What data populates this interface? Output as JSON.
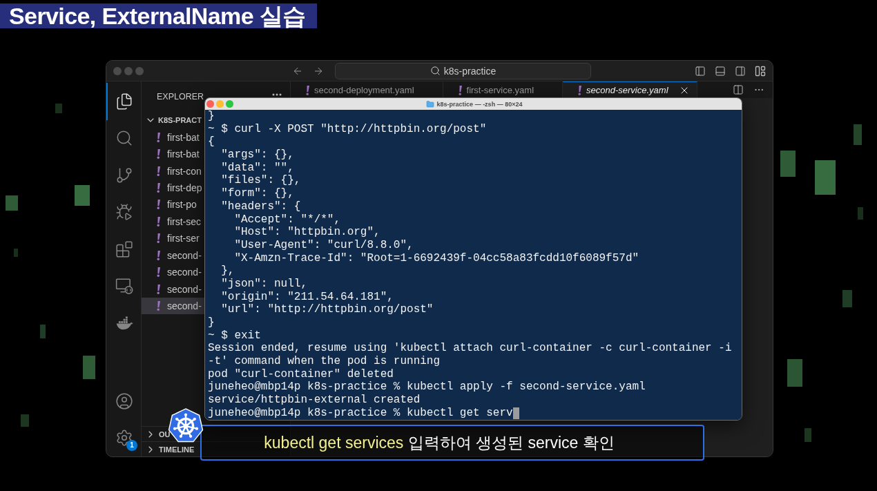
{
  "title_badge": {
    "text": "Service, ExternalName 실습"
  },
  "window": {
    "command_center": "k8s-practice"
  },
  "activity_bar": {
    "items": [
      {
        "kind": "explorer",
        "selected": true
      },
      {
        "kind": "search",
        "selected": false
      },
      {
        "kind": "source-control",
        "selected": false
      },
      {
        "kind": "run-debug",
        "selected": false
      },
      {
        "kind": "extensions",
        "selected": false
      },
      {
        "kind": "remote-explorer",
        "selected": false
      },
      {
        "kind": "docker",
        "selected": false
      }
    ],
    "bottom": [
      {
        "kind": "account"
      },
      {
        "kind": "settings",
        "badge": "1"
      }
    ]
  },
  "sidebar": {
    "title": "EXPLORER",
    "folder": {
      "label": "K8S-PRACT",
      "expanded": true,
      "children": [
        {
          "label": "first-bat",
          "selected": false
        },
        {
          "label": "first-bat",
          "selected": false
        },
        {
          "label": "first-con",
          "selected": false
        },
        {
          "label": "first-dep",
          "selected": false
        },
        {
          "label": "first-po",
          "selected": false
        },
        {
          "label": "first-sec",
          "selected": false
        },
        {
          "label": "first-ser",
          "selected": false
        },
        {
          "label": "second-",
          "selected": false
        },
        {
          "label": "second-",
          "selected": false
        },
        {
          "label": "second-",
          "selected": false
        },
        {
          "label": "second-",
          "selected": true
        }
      ]
    },
    "sections": [
      {
        "label": "OU",
        "expanded": false
      },
      {
        "label": "TIMELINE",
        "expanded": false
      }
    ]
  },
  "editor": {
    "tabs": [
      {
        "label": "second-deployment.yaml",
        "selected": false,
        "preview": false
      },
      {
        "label": "first-service.yaml",
        "selected": false,
        "preview": false
      },
      {
        "label": "second-service.yaml",
        "selected": true,
        "preview": true
      }
    ]
  },
  "terminal": {
    "title": "k8s-practice — -zsh — 80×24",
    "lines": [
      "}",
      "~ $ curl -X POST \"http://httpbin.org/post\"",
      "{",
      "  \"args\": {},",
      "  \"data\": \"\",",
      "  \"files\": {},",
      "  \"form\": {},",
      "  \"headers\": {",
      "    \"Accept\": \"*/*\",",
      "    \"Host\": \"httpbin.org\",",
      "    \"User-Agent\": \"curl/8.8.0\",",
      "    \"X-Amzn-Trace-Id\": \"Root=1-6692439f-04cc58a83fcdd10f6089f57d\"",
      "  },",
      "  \"json\": null,",
      "  \"origin\": \"211.54.64.181\",",
      "  \"url\": \"http://httpbin.org/post\"",
      "}",
      "~ $ exit",
      "Session ended, resume using 'kubectl attach curl-container -c curl-container -i",
      "-t' command when the pod is running",
      "pod \"curl-container\" deleted",
      "juneheo@mbp14p k8s-practice % kubectl apply -f second-service.yaml",
      "service/httpbin-external created",
      "juneheo@mbp14p k8s-practice % kubectl get serv"
    ],
    "cursor": true
  },
  "caption": {
    "highlight": "kubectl get services",
    "text": "입력하여 생성된 service 확인"
  }
}
